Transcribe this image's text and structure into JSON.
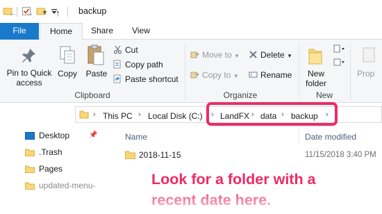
{
  "window": {
    "title": "backup"
  },
  "ribbon_tabs": {
    "file": "File",
    "home": "Home",
    "share": "Share",
    "view": "View"
  },
  "clipboard": {
    "pin_label": "Pin to Quick access",
    "copy_label": "Copy",
    "paste_label": "Paste",
    "cut_label": "Cut",
    "copy_path_label": "Copy path",
    "paste_shortcut_label": "Paste shortcut",
    "group_label": "Clipboard"
  },
  "organize": {
    "move_to_label": "Move to",
    "copy_to_label": "Copy to",
    "delete_label": "Delete",
    "rename_label": "Rename",
    "group_label": "Organize"
  },
  "new_group": {
    "new_folder_label": "New folder",
    "group_label": "New"
  },
  "open_group": {
    "properties_label": "Prop"
  },
  "address": {
    "crumbs": [
      "This PC",
      "Local Disk (C:)",
      "LandFX",
      "data",
      "backup"
    ]
  },
  "nav_pane": {
    "items": [
      "Desktop",
      ".Trash",
      "Pages",
      "updated-menu-"
    ]
  },
  "columns": {
    "name": "Name",
    "date_modified": "Date modified"
  },
  "rows": [
    {
      "name": "2018-11-15",
      "date": "11/15/2018 3:40 PM"
    }
  ],
  "annotation": {
    "text": "Look for a folder with a recent date here."
  },
  "colors": {
    "accent": "#1979ca",
    "highlight": "#ee2a64",
    "folder": "#f8d775"
  }
}
